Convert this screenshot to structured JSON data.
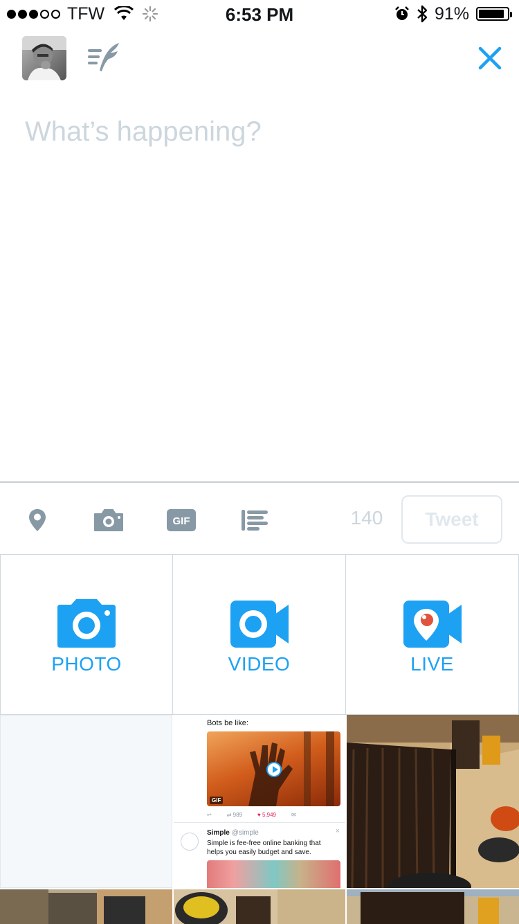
{
  "status_bar": {
    "carrier": "TFW",
    "time": "6:53 PM",
    "battery_pct": "91%",
    "battery_level": 0.91,
    "icons": [
      "signal-dots-icon",
      "wifi-icon",
      "activity-spinner-icon",
      "alarm-icon",
      "bluetooth-icon",
      "battery-icon"
    ]
  },
  "header": {
    "avatar_icon": "profile-avatar",
    "drafts_icon": "drafts-quill-icon",
    "close_icon": "close-icon"
  },
  "compose": {
    "placeholder": "What’s happening?",
    "value": ""
  },
  "toolbar": {
    "icons": [
      "location-pin-icon",
      "camera-icon",
      "gif-icon",
      "poll-icon"
    ],
    "gif_label": "GIF",
    "char_count": "140",
    "tweet_label": "Tweet"
  },
  "media_options": [
    {
      "label": "PHOTO",
      "icon": "photo-camera-icon"
    },
    {
      "label": "VIDEO",
      "icon": "video-camera-icon"
    },
    {
      "label": "LIVE",
      "icon": "live-periscope-icon"
    }
  ],
  "gallery": {
    "tweet_thumb": {
      "line1": "Bots be like:",
      "gif_tag": "GIF",
      "retweets": "989",
      "likes": "5,949",
      "ad_name": "Simple",
      "ad_handle": "@simple",
      "ad_body": "Simple is fee-free online banking that helps you easily budget and save."
    }
  },
  "colors": {
    "accent": "#1da1f2",
    "icon_gray": "#8899a6",
    "placeholder": "#ccd6dd",
    "border": "#cfd9de"
  }
}
